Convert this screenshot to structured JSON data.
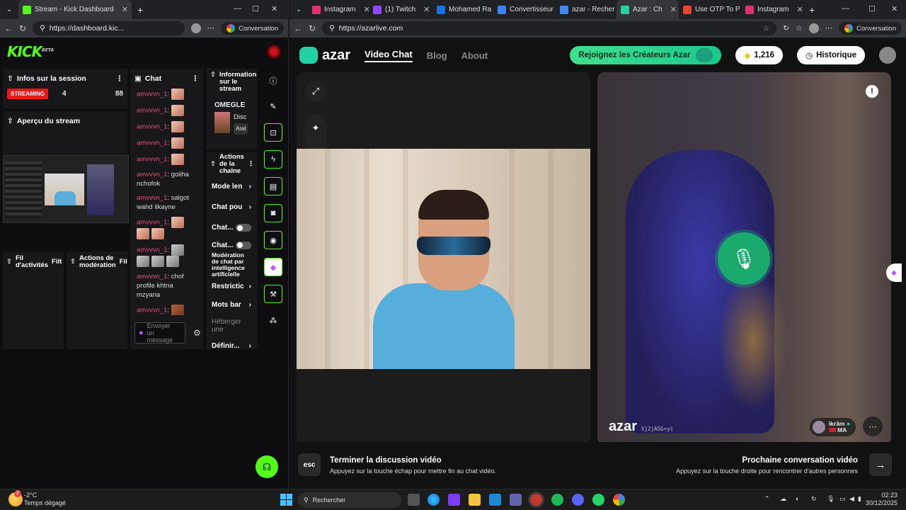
{
  "left_window": {
    "tab": {
      "title": "Stream - Kick Dashboard"
    },
    "url": "https://dashboard.kic...",
    "conversation_label": "Conversation",
    "kick": {
      "logo": "KICK",
      "logo_badge": "BETA",
      "session": {
        "title": "Infos sur la session",
        "status": "STREAMING",
        "viewers": "4",
        "count2": "88"
      },
      "preview": {
        "title": "Aperçu du stream"
      },
      "activity": {
        "title": "Fil d'activités",
        "filter": "Filt"
      },
      "moderation": {
        "title": "Actions de modération",
        "filter": "Fil"
      },
      "chat": {
        "title": "Chat",
        "messages": [
          {
            "user": "amvvvn_1",
            "text": ""
          },
          {
            "user": "amvvvn_1",
            "text": ""
          },
          {
            "user": "amvvvn_1",
            "text": ""
          },
          {
            "user": "amvvvn_1",
            "text": ""
          },
          {
            "user": "amvvvn_1",
            "text": ""
          },
          {
            "user": "amvvvn_1",
            "text": "goliha nchofok"
          },
          {
            "user": "amvvvn_1",
            "text": "salgot wahd likayne"
          },
          {
            "user": "amvvvn_1",
            "text": ""
          },
          {
            "user": "amvvvn_1",
            "text": ""
          },
          {
            "user": "amvvvn_1",
            "text": "chof profile khtna mzyana"
          },
          {
            "user": "amvvvn_1",
            "text": ""
          },
          {
            "user": "amvvvn_1",
            "text": ""
          }
        ],
        "input_placeholder": "Envoyer un message"
      },
      "stream_info": {
        "title": "Informations sur le stream",
        "category": "OMEGLE",
        "item1": "Disc",
        "item2": "Aral"
      },
      "channel_actions": {
        "title": "Actions de la chaîne",
        "rows": [
          "Mode len",
          "Chat pou",
          "Chat...",
          "Chat...",
          "Modération de chat par intelligence artificielle",
          "Restrictic",
          "Mots bar",
          "Héberger une",
          "Définir..."
        ]
      }
    }
  },
  "right_window": {
    "tabs": [
      {
        "title": "Instagram",
        "color": "#e1306c"
      },
      {
        "title": "(1) Twitch",
        "color": "#9146ff"
      },
      {
        "title": "Mohamed Ra",
        "color": "#1a73e8"
      },
      {
        "title": "Convertisseur",
        "color": "#3b82f6"
      },
      {
        "title": "azar - Recher",
        "color": "#4285f4"
      },
      {
        "title": "Azar : Ch",
        "color": "#23d2a2"
      },
      {
        "title": "Use OTP To P",
        "color": "#ea4335"
      },
      {
        "title": "Instagram",
        "color": "#e1306c"
      }
    ],
    "url": "https://azarlive.com",
    "conversation_label": "Conversation",
    "azar": {
      "logo": "azar",
      "nav": [
        "Video Chat",
        "Blog",
        "About"
      ],
      "creator_button": "Rejoignez les Créateurs Azar",
      "gems": "1,216",
      "history": "Historique",
      "peer": {
        "watermark": "azar",
        "id": "Vj2jASG+yi",
        "name": "ikrām",
        "country": "MA"
      },
      "end_chat": {
        "key": "esc",
        "title": "Terminer la discussion vidéo",
        "subtitle": "Appuyez sur la touche échap pour mettre fin au chat vidéo."
      },
      "next_chat": {
        "title": "Prochaine conversation vidéo",
        "subtitle": "Appuyez sur la touche droite pour rencontrer d'autres personnes"
      }
    }
  },
  "taskbar": {
    "weather_temp": "-2°C",
    "weather_text": "Temps dégagé",
    "search_placeholder": "Rechercher",
    "time": "02:23",
    "date": "30/12/2025",
    "weather_badge": "2"
  }
}
